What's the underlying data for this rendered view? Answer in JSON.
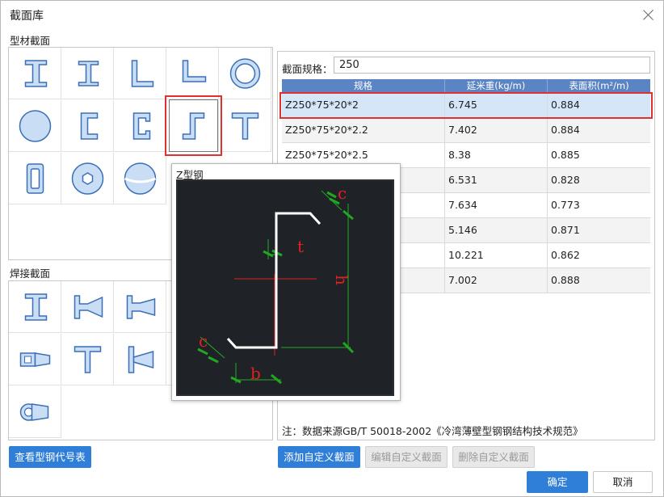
{
  "dialog": {
    "title": "截面库",
    "close_label": "×"
  },
  "profiles_section": {
    "title": "型材截面",
    "items": [
      {
        "icon": "i-beam-icon"
      },
      {
        "icon": "h-beam-icon"
      },
      {
        "icon": "equal-angle-icon"
      },
      {
        "icon": "unequal-angle-icon"
      },
      {
        "icon": "ring-tube-icon"
      },
      {
        "icon": "solid-circle-icon"
      },
      {
        "icon": "channel-icon"
      },
      {
        "icon": "lipped-channel-icon"
      },
      {
        "icon": "z-section-icon"
      },
      {
        "icon": "t-section-icon"
      },
      {
        "icon": "rectangular-tube-icon"
      },
      {
        "icon": "hexagon-bolt-icon"
      },
      {
        "icon": "sphere-icon"
      }
    ],
    "selected_index": 8
  },
  "welded_section": {
    "title": "焊接截面",
    "items": [
      {
        "icon": "welded-i-beam-icon"
      },
      {
        "icon": "tapered-i-beam-icon"
      },
      {
        "icon": "tapered-i-beam-2-icon"
      },
      {
        "icon": "welded-box-icon"
      },
      {
        "icon": "welded-box-tapered-icon"
      },
      {
        "icon": "welded-box-tapered-2-icon"
      },
      {
        "icon": "welded-t-icon"
      },
      {
        "icon": "tapered-t-icon"
      },
      {
        "icon": "double-i-icon"
      },
      {
        "icon": "welded-u-icon"
      },
      {
        "icon": "tapered-ring-icon"
      }
    ]
  },
  "buttons": {
    "view_code_table": "查看型钢代号表",
    "add_custom": "添加自定义截面",
    "edit_custom": "编辑自定义截面",
    "delete_custom": "删除自定义截面",
    "ok": "确定",
    "cancel": "取消"
  },
  "spec": {
    "label": "截面规格：",
    "value": "250"
  },
  "table": {
    "columns": [
      "规格",
      "延米重(kg/m)",
      "表面积(m²/m)"
    ],
    "rows": [
      [
        "Z250*75*20*2",
        "6.745",
        "0.884"
      ],
      [
        "Z250*75*20*2.2",
        "7.402",
        "0.884"
      ],
      [
        "Z250*75*20*2.5",
        "8.38",
        "0.885"
      ],
      [
        "",
        "6.531",
        "0.828"
      ],
      [
        "",
        "7.634",
        "0.773"
      ],
      [
        "",
        "5.146",
        "0.871"
      ],
      [
        "",
        "10.221",
        "0.862"
      ],
      [
        "",
        "7.002",
        "0.888"
      ]
    ],
    "selected_row": 0
  },
  "note": "注：数据来源GB/T 50018-2002《冷湾薄壁型钢钢结构技术规范》",
  "preview": {
    "title": "Z型钢",
    "labels": {
      "c_top": "c",
      "t": "t",
      "h": "h",
      "c_bottom": "c",
      "b": "b"
    }
  },
  "colors": {
    "accent": "#2f7ed8",
    "header": "#5b84c4",
    "selection": "#e03131",
    "icon_fill": "#c9def5",
    "icon_stroke": "#3b6fb6"
  }
}
